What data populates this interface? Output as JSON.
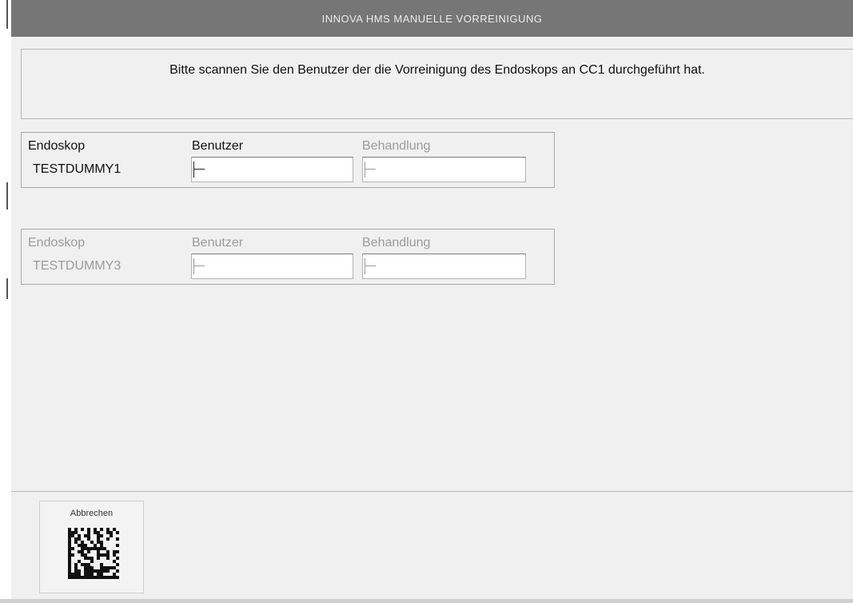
{
  "window": {
    "title": "INNOVA HMS MANUELLE VORREINIGUNG"
  },
  "instruction": {
    "text": "Bitte scannen Sie den Benutzer der die Vorreinigung des Endoskops an CC1 durchgeführt hat."
  },
  "rows": [
    {
      "state": "active",
      "endoscope_header": "Endoskop",
      "endoscope_value": "TESTDUMMY1",
      "user_header": "Benutzer",
      "user_value": "",
      "treatment_header": "Behandlung",
      "treatment_value": ""
    },
    {
      "state": "disabled",
      "endoscope_header": "Endoskop",
      "endoscope_value": "TESTDUMMY3",
      "user_header": "Benutzer",
      "user_value": "",
      "treatment_header": "Behandlung",
      "treatment_value": ""
    }
  ],
  "footer": {
    "cancel_label": "Abbrechen",
    "cancel_icon": "datamatrix-barcode-icon"
  },
  "colors": {
    "titlebar": "#767676",
    "background": "#f0f0f0",
    "disabled_text": "#9b9b9b"
  }
}
